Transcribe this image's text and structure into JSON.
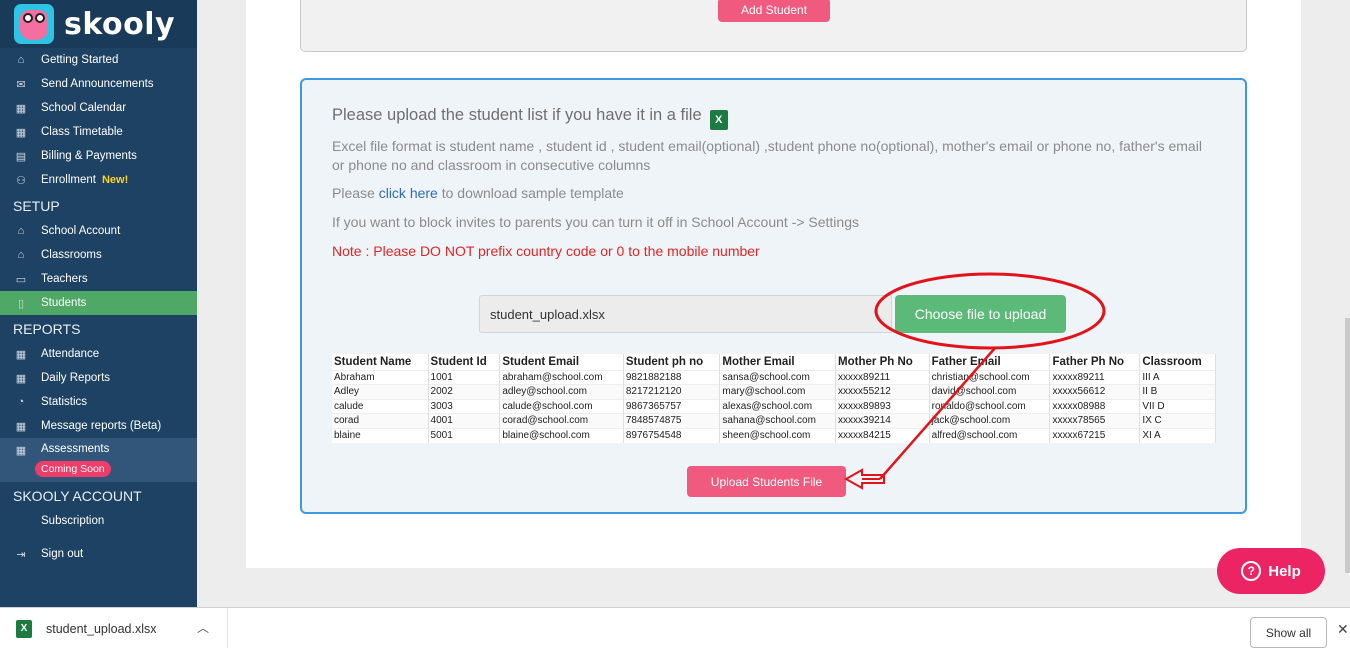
{
  "brand": {
    "name": "skooly"
  },
  "sidebar": {
    "items_top": [
      {
        "label": "Getting Started",
        "icon": "⌂"
      },
      {
        "label": "Send Announcements",
        "icon": "✉"
      },
      {
        "label": "School Calendar",
        "icon": "▦"
      },
      {
        "label": "Class Timetable",
        "icon": "▦"
      },
      {
        "label": "Billing & Payments",
        "icon": "▤"
      },
      {
        "label": "Enrollment",
        "icon": "⚇",
        "badge": "New!"
      }
    ],
    "setup_title": "SETUP",
    "items_setup": [
      {
        "label": "School Account",
        "icon": "⌂"
      },
      {
        "label": "Classrooms",
        "icon": "⌂"
      },
      {
        "label": "Teachers",
        "icon": "▭"
      },
      {
        "label": "Students",
        "icon": "▯"
      }
    ],
    "reports_title": "REPORTS",
    "items_reports": [
      {
        "label": "Attendance",
        "icon": "▦"
      },
      {
        "label": "Daily Reports",
        "icon": "▦"
      },
      {
        "label": "Statistics",
        "icon": "◔"
      },
      {
        "label": "Message reports (Beta)",
        "icon": "▦"
      },
      {
        "label": "Assessments",
        "icon": "▦",
        "badge": "Coming Soon"
      }
    ],
    "account_title": "SKOOLY ACCOUNT",
    "items_account": [
      {
        "label": "Subscription",
        "icon": ""
      },
      {
        "label": "Sign out",
        "icon": "⇥"
      }
    ]
  },
  "top_card": {
    "add_student": "Add Student"
  },
  "upload": {
    "heading": "Please upload the student list if you have it in a file",
    "format_text": "Excel file format is student name , student id , student email(optional) ,student phone no(optional), mother's email or phone no, father's email or phone no and classroom in consecutive columns",
    "template_prefix": "Please ",
    "template_link": "click here",
    "template_suffix": " to download sample template",
    "block_text": "If you want to block invites to parents you can turn it off in School Account -> Settings",
    "note": "Note : Please DO NOT prefix country code or 0 to the mobile number",
    "file_value": "student_upload.xlsx",
    "choose_button": "Choose file to upload",
    "upload_button": "Upload Students File",
    "table": {
      "headers": [
        "Student Name",
        "Student Id",
        "Student Email",
        "Student ph no",
        "Mother Email",
        "Mother Ph No",
        "Father Email",
        "Father Ph No",
        "Classroom"
      ],
      "rows": [
        [
          "Abraham",
          "1001",
          "abraham@school.com",
          "9821882188",
          "sansa@school.com",
          "xxxxx89211",
          "christian@school.com",
          "xxxxx89211",
          "III A"
        ],
        [
          "Adley",
          "2002",
          "adley@school.com",
          "8217212120",
          "mary@school.com",
          "xxxxx55212",
          "david@school.com",
          "xxxxx56612",
          "II B"
        ],
        [
          "calude",
          "3003",
          "calude@school.com",
          "9867365757",
          "alexas@school.com",
          "xxxxx89893",
          "ronaldo@school.com",
          "xxxxx08988",
          "VII D"
        ],
        [
          "corad",
          "4001",
          "corad@school.com",
          "7848574875",
          "sahana@school.com",
          "xxxxx39214",
          "jack@school.com",
          "xxxxx78565",
          "IX C"
        ],
        [
          "blaine",
          "5001",
          "blaine@school.com",
          "8976754548",
          "sheen@school.com",
          "xxxxx84215",
          "alfred@school.com",
          "xxxxx67215",
          "XI A"
        ]
      ]
    }
  },
  "help": {
    "label": "Help"
  },
  "download_bar": {
    "file_name": "student_upload.xlsx",
    "show_all": "Show all"
  },
  "colors": {
    "sidebar": "#1e4263",
    "accent_pink": "#ef5a7e",
    "accent_green": "#5cba79",
    "border_blue": "#3d9ae0",
    "annotation_red": "#e3131b"
  }
}
